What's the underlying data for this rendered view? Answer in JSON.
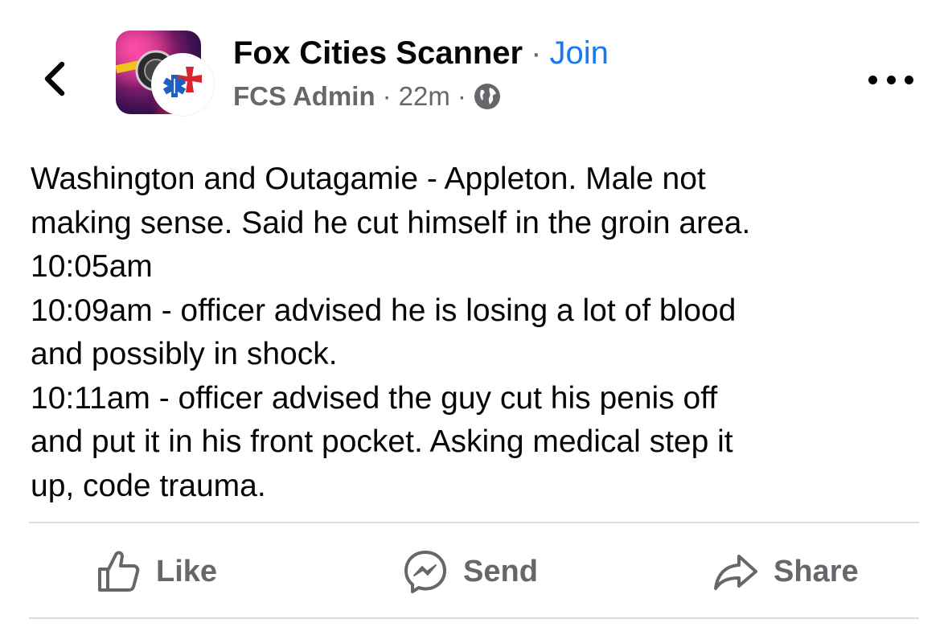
{
  "header": {
    "group_name": "Fox Cities Scanner",
    "separator": "·",
    "join_label": "Join",
    "author": "FCS Admin",
    "time": "22m",
    "meta_separator": "·",
    "privacy_icon": "globe-icon",
    "back_icon": "chevron-left-icon",
    "more_icon": "ellipsis-horizontal-icon"
  },
  "post": {
    "lines": [
      "Washington and Outagamie - Appleton. Male not",
      "making sense. Said he cut himself in the groin area.",
      "10:05am",
      "10:09am - officer advised he is losing a lot of blood",
      "and possibly in shock.",
      "10:11am - officer advised the guy cut his penis off",
      "and put it in his front pocket. Asking medical step it",
      "up, code trauma."
    ]
  },
  "actions": {
    "like_label": "Like",
    "send_label": "Send",
    "share_label": "Share",
    "like_icon": "thumbs-up-icon",
    "send_icon": "messenger-icon",
    "share_icon": "share-arrow-icon"
  },
  "colors": {
    "accent": "#1877f2",
    "secondary_text": "#65676b",
    "primary_text": "#050505",
    "divider": "#dadde1"
  }
}
